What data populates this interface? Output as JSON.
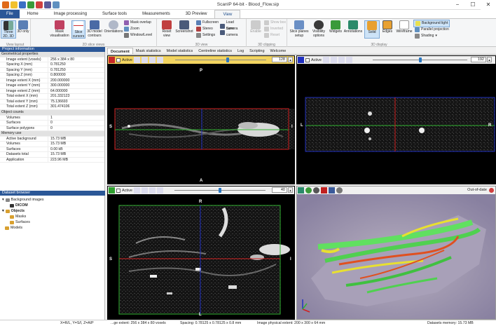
{
  "app": {
    "title": "ScanIP 64-bit - Blood_Flow.sip",
    "window_buttons": [
      "−",
      "☐",
      "✕"
    ]
  },
  "ribbon_tabs": [
    {
      "label": "File"
    },
    {
      "label": "Home"
    },
    {
      "label": "Image processing"
    },
    {
      "label": "Surface tools"
    },
    {
      "label": "Measurements"
    },
    {
      "label": "3D Preview"
    },
    {
      "label": "View"
    }
  ],
  "ribbon": {
    "groups": [
      {
        "name": "View layout"
      },
      {
        "name": "2D slice views"
      },
      {
        "name": "3D view"
      },
      {
        "name": "3D clipping"
      },
      {
        "name": "3D display"
      }
    ],
    "buttons": {
      "three_2d_3d": "Three 2D, 3D",
      "only_3d": "3D only",
      "mask_visualisation": "Mask visualisation",
      "slice_cursors": "Slice cursors",
      "model_contours": "3D model contours",
      "orientations": "Orientations",
      "mask_overlap": "Mask overlap",
      "zoom": "Zoom",
      "window_level": "Window/Level",
      "reset_view": "Reset view",
      "screenshot": "Screenshot",
      "fullscreen": "Fullscreen",
      "stereo": "Stereo",
      "settings": "Settings",
      "load_camera": "Load camera",
      "save_camera": "Save camera",
      "enable": "Enable",
      "show_box": "Show box",
      "inverted": "Inverted",
      "reset": "Reset",
      "slice_planes_setup": "Slice planes setup",
      "visibility_options": "Visibility options",
      "widgets": "Widgets",
      "annotations": "Annotations",
      "solid": "Solid",
      "edges": "Edges",
      "wireframe": "Wireframe",
      "background_light": "Background light",
      "parallel_projection": "Parallel projection",
      "shading": "Shading"
    }
  },
  "project_info": {
    "header": "Project information",
    "sections": [
      {
        "title": "Geometrical properties",
        "rows": [
          {
            "k": "Image extent (voxels)",
            "v": "256 x 384 x 80"
          },
          {
            "k": "Spacing X (mm)",
            "v": "0.781250"
          },
          {
            "k": "Spacing Y (mm)",
            "v": "0.781250"
          },
          {
            "k": "Spacing Z (mm)",
            "v": "0.800000"
          },
          {
            "k": "Image extent X (mm)",
            "v": "200.000000"
          },
          {
            "k": "Image extent Y (mm)",
            "v": "300.000000"
          },
          {
            "k": "Image extent Z (mm)",
            "v": "64.000000"
          },
          {
            "k": "Total extent X (mm)",
            "v": "201.332123"
          },
          {
            "k": "Total extent Y (mm)",
            "v": "75.136693"
          },
          {
            "k": "Total extent Z (mm)",
            "v": "301.474106"
          }
        ]
      },
      {
        "title": "Object counts",
        "rows": [
          {
            "k": "Volumes",
            "v": "1"
          },
          {
            "k": "Surfaces",
            "v": "0"
          },
          {
            "k": "Surface polygons",
            "v": "0"
          }
        ]
      },
      {
        "title": "Memory use",
        "rows": [
          {
            "k": "Active background",
            "v": "15.73 MB"
          },
          {
            "k": "Volumes",
            "v": "15.73 MB"
          },
          {
            "k": "Surfaces",
            "v": "0.00 kB"
          },
          {
            "k": "Datasets total",
            "v": "15.73 MB"
          },
          {
            "k": "Application",
            "v": "223.96 MB"
          }
        ]
      }
    ]
  },
  "dataset_browser": {
    "header": "Dataset browser",
    "background_images": "Background images",
    "dicom": "DICOM",
    "objects": "Objects",
    "masks": "Masks",
    "surfaces": "Surfaces",
    "models": "Models"
  },
  "doc_tabs": [
    {
      "label": "Document"
    },
    {
      "label": "Mask statistics"
    },
    {
      "label": "Model statistics"
    },
    {
      "label": "Centreline statistics"
    },
    {
      "label": "Log"
    },
    {
      "label": "Scripting"
    },
    {
      "label": "Welcome"
    }
  ],
  "viewports": {
    "active_label": "Active",
    "top_left": {
      "slice": "128",
      "slider_fraction": 0.58,
      "top": "P",
      "bottom": "A",
      "left": "S",
      "right": "I"
    },
    "top_right": {
      "slice": "192",
      "slider_fraction": 0.5,
      "left": "L",
      "right": "R"
    },
    "bottom_left": {
      "slice": "40",
      "slider_fraction": 0.5,
      "top": "R",
      "bottom": "L",
      "left": "S",
      "right": "I"
    },
    "view_3d": {
      "status": "Out-of-date"
    }
  },
  "status": {
    "coords": "X=R/L, Y=S/I, Z=A/P",
    "image_extent": "...ge extent: 256 x 384 x 80 voxels",
    "spacing": "Spacing: 0.78125 x 0.78125 x 0.8 mm",
    "physical": "Image physical extent: 200 x 300 x 64 mm",
    "memory": "Datasets memory: 15.73 MB"
  },
  "colors": {
    "accent": "#2b5797",
    "viewport_red": "#d02020",
    "viewport_blue": "#2030c0",
    "viewport_green": "#30b030"
  }
}
